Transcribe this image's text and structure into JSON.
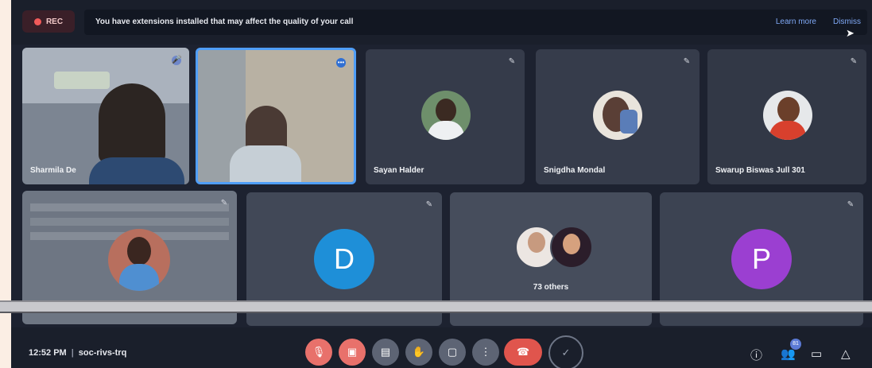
{
  "top": {
    "rec_label": "REC",
    "notice": "You have extensions installed that may affect the quality of your call",
    "learn_more": "Learn more",
    "dismiss": "Dismiss"
  },
  "participants": [
    {
      "name": "Sharmila De"
    },
    {
      "name": ""
    },
    {
      "name": "Sayan Halder"
    },
    {
      "name": "Snigdha Mondal"
    },
    {
      "name": "Swarup Biswas Jull 301"
    },
    {
      "name": ""
    },
    {
      "name": "",
      "initial": "D"
    },
    {
      "name": "",
      "others": "73 others"
    },
    {
      "name": "",
      "initial": "P"
    }
  ],
  "bottom": {
    "time": "12:52 PM",
    "meeting_code": "soc-rivs-trq",
    "people_badge": "81"
  },
  "colors": {
    "accent_blue": "#4f9ef8",
    "end_call": "#e0554d",
    "mic_off": "#e8716b",
    "avatar_d": "#1e8fd8",
    "avatar_p": "#9b3fd1"
  },
  "icons": [
    "mic-off-icon",
    "camera-off-icon",
    "captions-icon",
    "raise-hand-icon",
    "present-icon",
    "more-options-icon",
    "end-call-icon",
    "info-icon",
    "people-icon",
    "chat-icon",
    "activities-icon"
  ]
}
